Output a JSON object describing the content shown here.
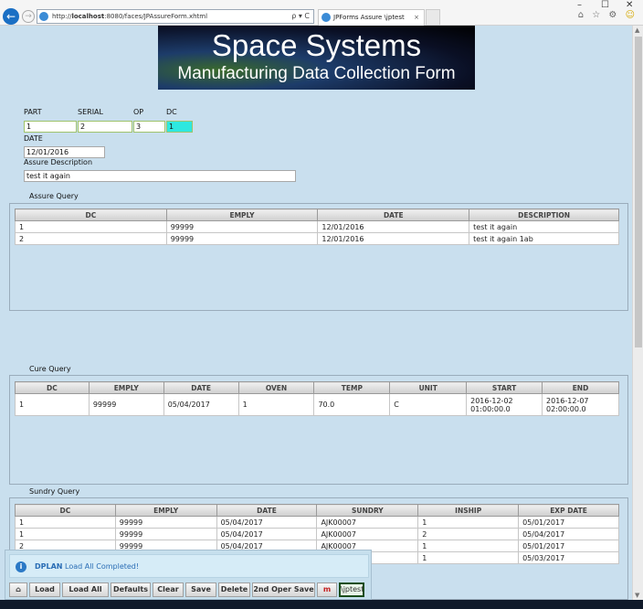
{
  "browser": {
    "url_prefix": "http://",
    "url_host": "localhost",
    "url_rest": ":8080/faces/JPAssureForm.xhtml",
    "url_controls": "ρ ▾ C",
    "tab_title": "JPForms Assure \\jptest",
    "tab_close": "×",
    "minimize": "–",
    "maximize": "☐",
    "close": "✕",
    "tool_icons": "⌂ ☆ ⚙",
    "smiley": "☺"
  },
  "banner": {
    "line1": "Space Systems",
    "line2": "Manufacturing Data Collection Form"
  },
  "form": {
    "part_label": "PART",
    "serial_label": "SERIAL",
    "op_label": "OP",
    "dc_label": "DC",
    "part_value": "1",
    "serial_value": "2",
    "op_value": "3",
    "dc_value": "1",
    "date_label": "DATE",
    "date_value": "12/01/2016",
    "desc_label": "Assure Description",
    "desc_value": "test it again"
  },
  "assure": {
    "title": "Assure Query",
    "headers": [
      "DC",
      "EMPLY",
      "DATE",
      "DESCRIPTION"
    ],
    "rows": [
      [
        "1",
        "99999",
        "12/01/2016",
        "test it again"
      ],
      [
        "2",
        "99999",
        "12/01/2016",
        "test it again 1ab"
      ]
    ]
  },
  "cure": {
    "title": "Cure Query",
    "headers": [
      "DC",
      "EMPLY",
      "DATE",
      "OVEN",
      "TEMP",
      "UNIT",
      "START",
      "END"
    ],
    "rows": [
      [
        "1",
        "99999",
        "05/04/2017",
        "1",
        "70.0",
        "C",
        "2016-12-02 01:00:00.0",
        "2016-12-07 02:00:00.0"
      ]
    ]
  },
  "sundry": {
    "title": "Sundry Query",
    "headers": [
      "DC",
      "EMPLY",
      "DATE",
      "SUNDRY",
      "INSHIP",
      "EXP DATE"
    ],
    "rows": [
      [
        "1",
        "99999",
        "05/04/2017",
        "AJK00007",
        "1",
        "05/01/2017"
      ],
      [
        "1",
        "99999",
        "05/04/2017",
        "AJK00007",
        "2",
        "05/04/2017"
      ],
      [
        "2",
        "99999",
        "05/04/2017",
        "AJK00007",
        "1",
        "05/01/2017"
      ],
      [
        "",
        "",
        "",
        "",
        "1",
        "05/03/2017"
      ]
    ]
  },
  "growl": {
    "title": "DPLAN",
    "message": "Load All Completed!",
    "info_glyph": "i"
  },
  "toolbar": {
    "home": "⌂",
    "load": "Load",
    "load_all": "Load All",
    "defaults": "Defaults",
    "clear": "Clear",
    "save": "Save",
    "delete": "Delete",
    "second_oper_save": "2nd Oper Save",
    "m": "m",
    "user": "\\jptest"
  }
}
